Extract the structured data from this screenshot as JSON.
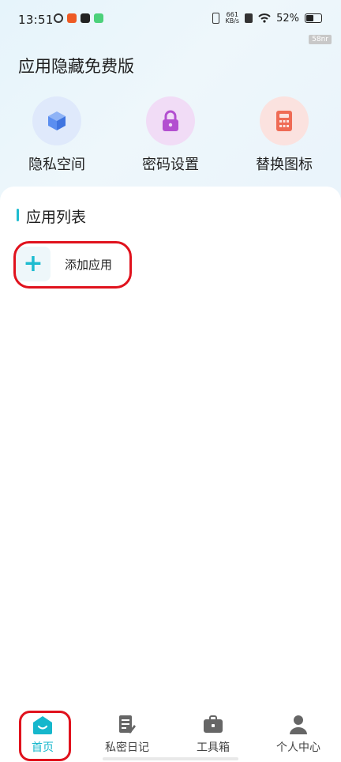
{
  "status_bar": {
    "time": "13:51",
    "net_speed_value": "661",
    "net_speed_unit": "KB/s",
    "battery": "52%",
    "battery_level": 0.52
  },
  "badge": "58nr",
  "app_title": "应用隐藏免费版",
  "features": [
    {
      "label": "隐私空间",
      "icon": "cube-icon",
      "bg": "#dfe9fb",
      "color": "#5b8ef0"
    },
    {
      "label": "密码设置",
      "icon": "lock-icon",
      "bg": "#f1dcf6",
      "color": "#b34fd0"
    },
    {
      "label": "替换图标",
      "icon": "calculator-icon",
      "bg": "#fbe2df",
      "color": "#ef6b55"
    }
  ],
  "section": {
    "title": "应用列表",
    "add_button_label": "添加应用"
  },
  "tabs": [
    {
      "label": "首页",
      "icon": "home-icon",
      "active": true
    },
    {
      "label": "私密日记",
      "icon": "diary-icon",
      "active": false
    },
    {
      "label": "工具箱",
      "icon": "toolbox-icon",
      "active": false
    },
    {
      "label": "个人中心",
      "icon": "person-icon",
      "active": false
    }
  ],
  "colors": {
    "accent": "#16b7cc",
    "highlight": "#e0121d"
  }
}
